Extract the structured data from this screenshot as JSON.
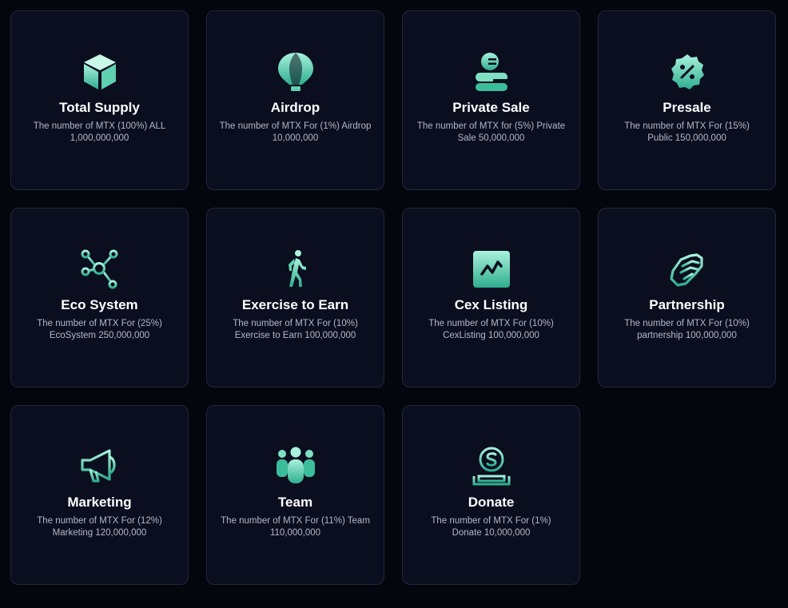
{
  "colors": {
    "background": "#03060d",
    "card": "#0b0e1f",
    "card_border": "#23283a",
    "icon_light": "#a9f2dc",
    "icon_dark": "#2fae8e",
    "title": "#ffffff",
    "desc": "#b3b8c6"
  },
  "cards": [
    {
      "icon": "cube-icon",
      "title": "Total Supply",
      "desc": "The number of MTX (100%) ALL 1,000,000,000"
    },
    {
      "icon": "hot-air-balloon-icon",
      "title": "Airdrop",
      "desc": "The number of MTX For (1%) Airdrop 10,000,000"
    },
    {
      "icon": "coin-hand-icon",
      "title": "Private Sale",
      "desc": "The number of MTX for (5%) Private Sale 50,000,000"
    },
    {
      "icon": "percent-badge-icon",
      "title": "Presale",
      "desc": "The number of MTX For (15%) Public 150,000,000"
    },
    {
      "icon": "network-nodes-icon",
      "title": "Eco System",
      "desc": "The number of MTX For (25%) EcoSystem 250,000,000"
    },
    {
      "icon": "walking-person-icon",
      "title": "Exercise to Earn",
      "desc": "The number of MTX For (10%) Exercise to Earn 100,000,000"
    },
    {
      "icon": "trend-chart-icon",
      "title": "Cex Listing",
      "desc": "The number of MTX For (10%) CexListing 100,000,000"
    },
    {
      "icon": "handshake-icon",
      "title": "Partnership",
      "desc": "The number of MTX For (10%) partnership 100,000,000"
    },
    {
      "icon": "megaphone-icon",
      "title": "Marketing",
      "desc": "The number of MTX For (12%) Marketing 120,000,000"
    },
    {
      "icon": "team-people-icon",
      "title": "Team",
      "desc": "The number of MTX For (11%) Team 110,000,000"
    },
    {
      "icon": "dollar-donate-icon",
      "title": "Donate",
      "desc": "The number of MTX For (1%) Donate 10,000,000"
    }
  ]
}
